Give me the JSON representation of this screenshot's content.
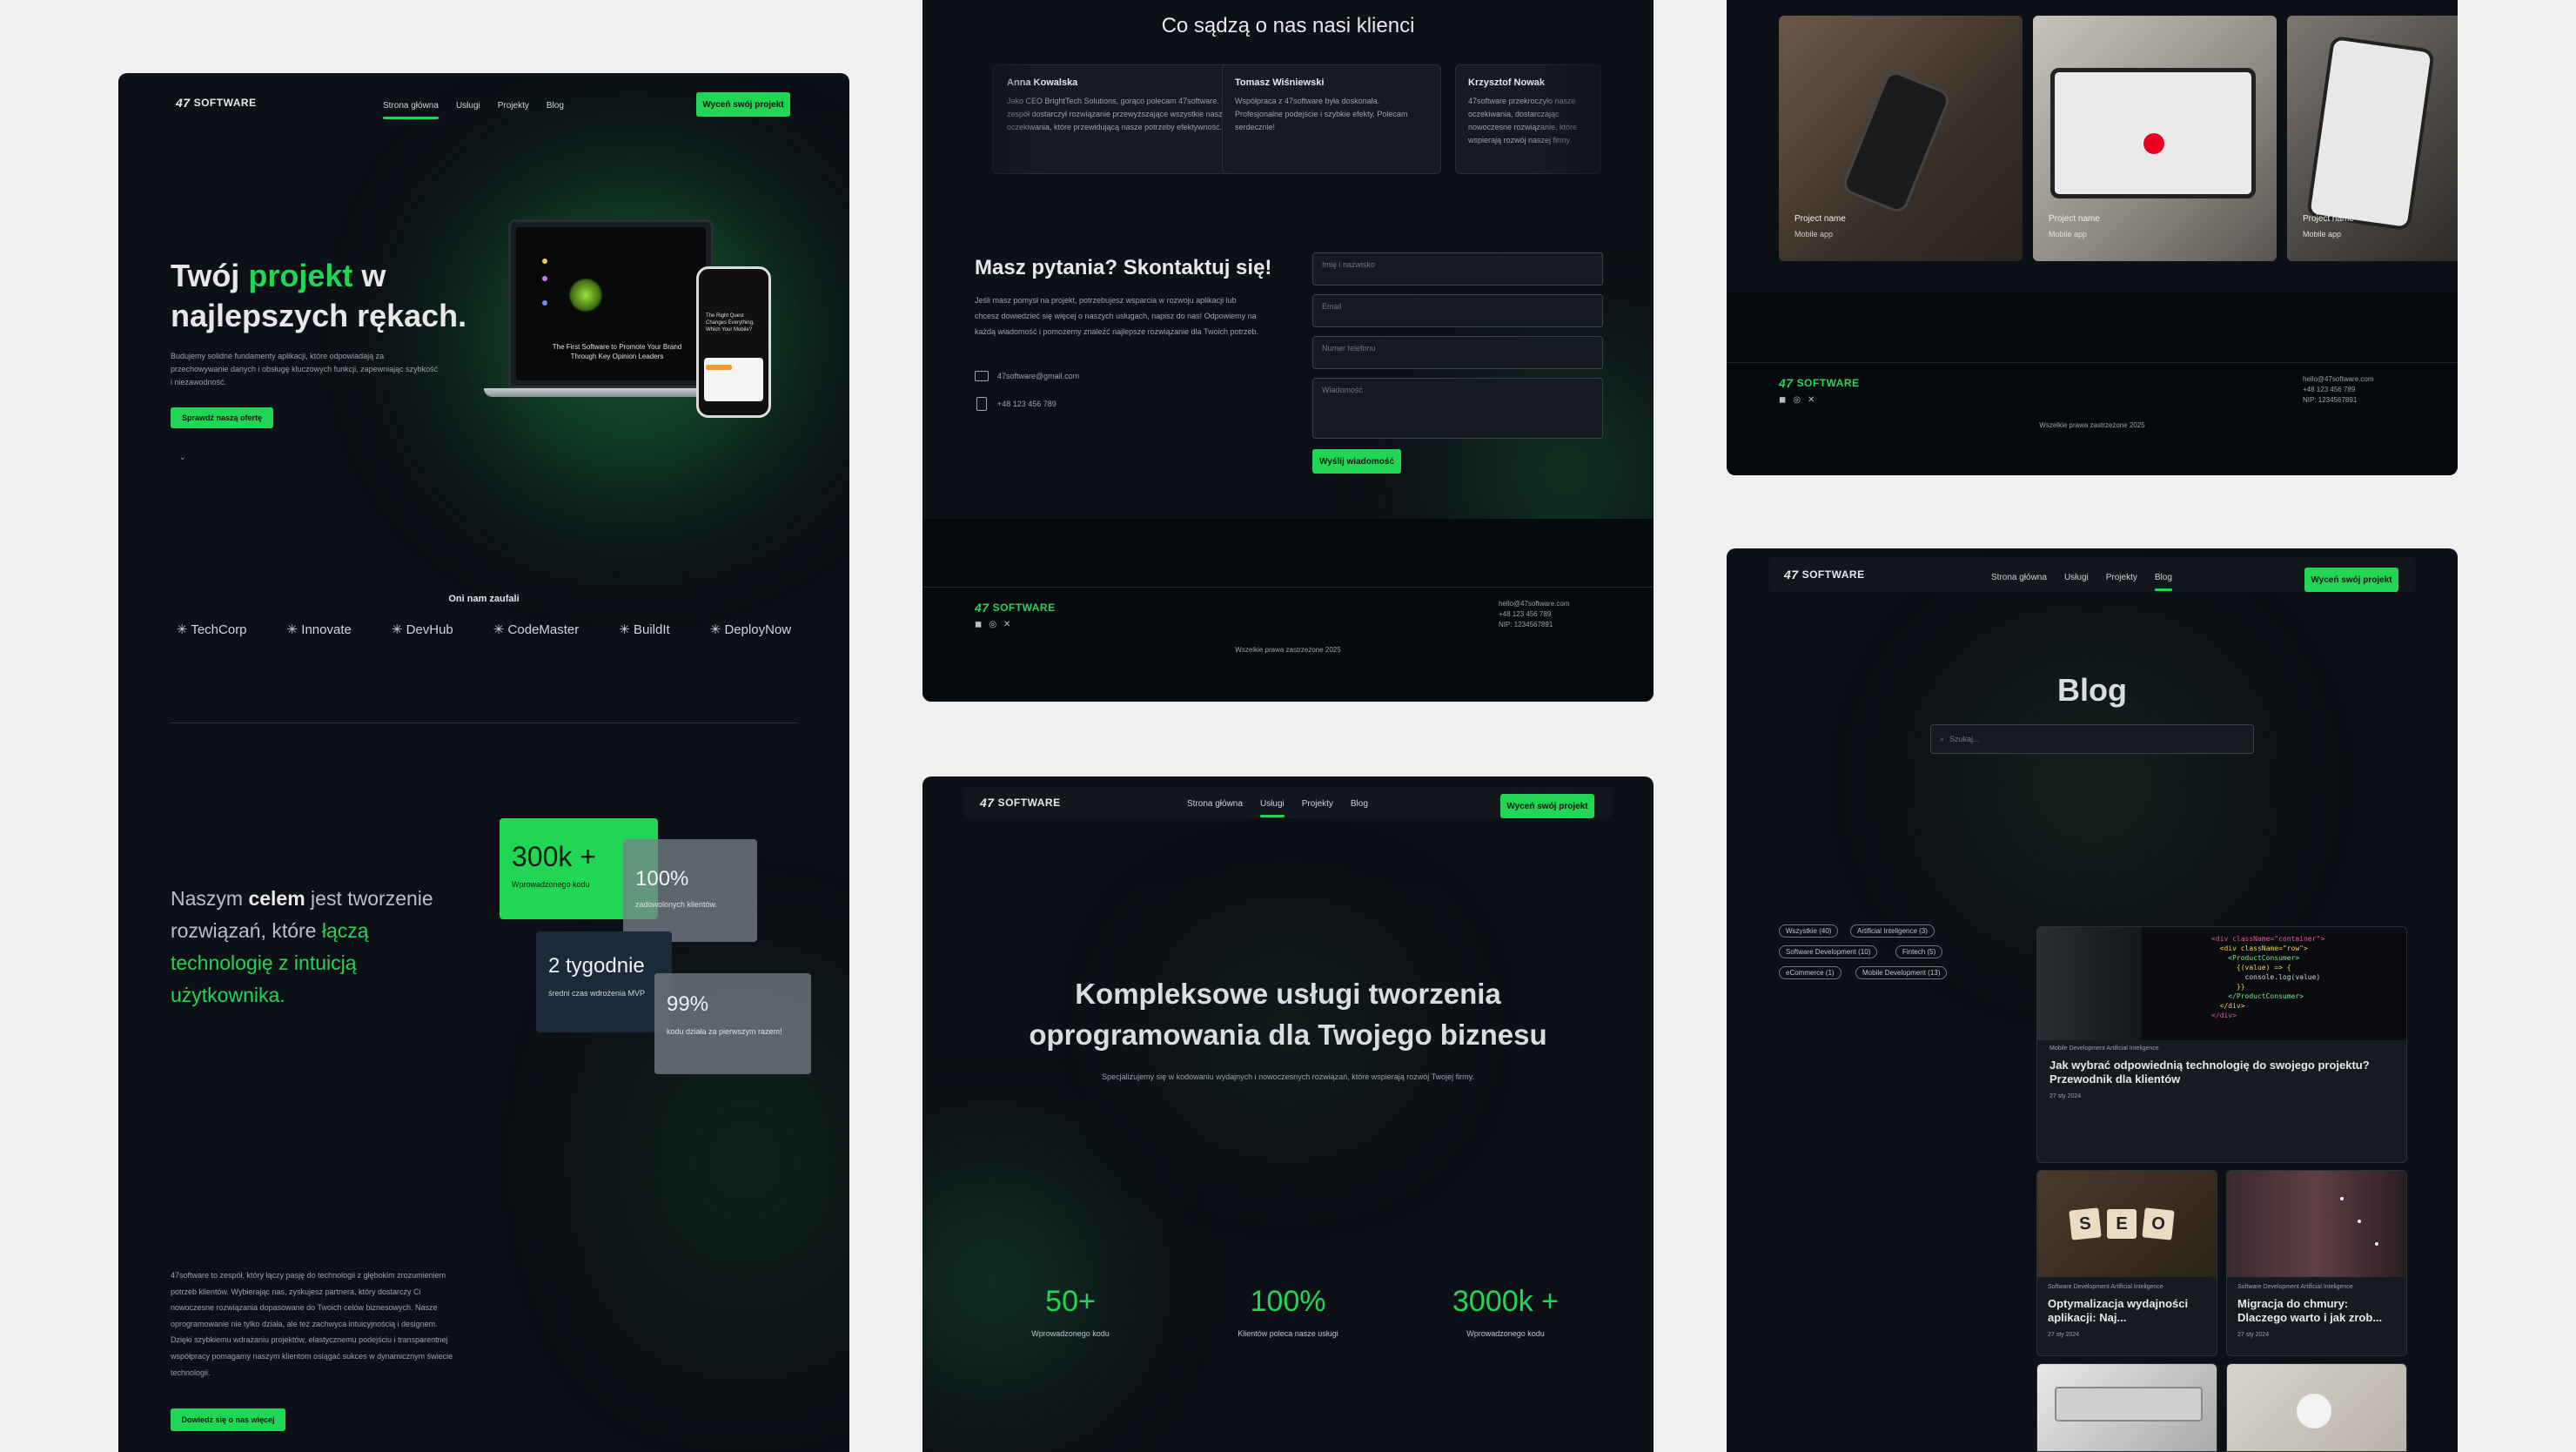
{
  "brand": {
    "logo_mark": "47",
    "logo_text": "SOFTWARE"
  },
  "nav": {
    "home": "Strona główna",
    "services": "Usługi",
    "projects": "Projekty",
    "blog": "Blog",
    "cta": "Wyceń swój projekt"
  },
  "home": {
    "hero_title_1": "Twój ",
    "hero_title_accent": "projekt",
    "hero_title_2": " w",
    "hero_title_3": "najlepszych rękach.",
    "hero_text": "Budujemy solidne fundamenty aplikacji, które odpowiadają za przechowywanie danych i obsługę kluczowych funkcji, zapewniając szybkość i niezawodność.",
    "hero_button": "Sprawdź naszą ofertę",
    "mock_caption_1": "The First Software to Promote Your Brand",
    "mock_caption_2": "Through Key Opinion Leaders",
    "phone_caption": "The Right Quest Changes Everything. Which Your Mobile?",
    "trusted_title": "Oni nam zaufali",
    "clients": [
      "TechCorp",
      "Innovate",
      "DevHub",
      "CodeMaster",
      "BuildIt",
      "DeployNow"
    ],
    "mission_1": "Naszym ",
    "mission_bold_1": "celem",
    "mission_2": " jest tworzenie rozwiązań, które ",
    "mission_accent": "łączą technologię z intuicją użytkownika.",
    "stats": [
      {
        "value": "300k +",
        "label": "Wprowadzonego kodu"
      },
      {
        "value": "100%",
        "label": "zadowolonych klientów."
      },
      {
        "value": "2 tygodnie",
        "label": "średni czas wdrożenia MVP"
      },
      {
        "value": "99%",
        "label": "kodu działa za pierwszym razem!"
      }
    ],
    "about_text": "47software to zespół, który łączy pasję do technologii z głębokim zrozumieniem potrzeb klientów. Wybierając nas, zyskujesz partnera, który dostarczy Ci nowoczesne rozwiązania dopasowane do Twoich celów biznesowych. Nasze oprogramowanie nie tylko działa, ale też zachwyca intuicyjnością i designem. Dzięki szybkiemu wdrażaniu projektów, elastycznemu podejściu i transparentnej współpracy pomagamy naszym klientom osiągać sukces w dynamicznym świecie technologii.",
    "about_button": "Dowiedz się o nas więcej"
  },
  "contact": {
    "testimonials_title": "Co sądzą o  nas nasi klienci",
    "testimonials": [
      {
        "name": "Anna Kowalska",
        "text": "Jako CEO BrightTech Solutions, gorąco polecam 47software. Ich zespół dostarczył rozwiązanie przewyższające wszystkie nasze oczekiwania, które przewidującą nasze potrzeby efektywność."
      },
      {
        "name": "Tomasz Wiśniewski",
        "text": "Współpraca z 47software była doskonała. Profesjonalne podejście i szybkie efekty. Polecam serdecznie!"
      },
      {
        "name": "Krzysztof Nowak",
        "text": "47software przekroczyło nasze oczekiwania, dostarczając nowoczesne rozwiązanie, które wspierają rozwój naszej firmy."
      }
    ],
    "title": "Masz pytania? Skontaktuj się!",
    "text": "Jeśli masz pomysł na projekt, potrzebujesz wsparcia w rozwoju aplikacji lub chcesz dowiedzieć się więcej o naszych usługach, napisz do nas! Odpowiemy na każdą wiadomość i pomożemy znaleźć najlepsze rozwiązanie dla Twoich potrzeb.",
    "email": "47software@gmail.com",
    "phone": "+48 123 456 789",
    "ph_name": "Imię i nazwisko",
    "ph_email": "Email",
    "ph_phone": "Numer telefonu",
    "ph_message": "Wiadomość",
    "submit": "Wyślij wiadomość"
  },
  "footer": {
    "email": "hello@47software.com",
    "phone": "+48 123 456 789",
    "nip": "NIP: 1234567891",
    "rights": "Wszelkie prawa zastrzeżone 2025"
  },
  "projects": [
    {
      "name": "Project name",
      "type": "Mobile app"
    },
    {
      "name": "Project name",
      "type": "Mobile app"
    },
    {
      "name": "Project name",
      "type": "Mobile app"
    }
  ],
  "services": {
    "title_1": "Kompleksowe usługi tworzenia",
    "title_2": "oprogramowania dla Twojego biznesu",
    "subtitle": "Specjalizujemy się w kodowaniu wydajnych i nowoczesnych rozwiązań, które wspierają rozwój Twojej firmy.",
    "stats": [
      {
        "value": "50+",
        "label": "Wprowadzonego kodu"
      },
      {
        "value": "100%",
        "label": "Klientów poleca nasze usługi"
      },
      {
        "value": "3000k +",
        "label": "Wprowadzonego kodu"
      }
    ]
  },
  "blog": {
    "title": "Blog",
    "search_placeholder": "Szukaj...",
    "tags": [
      "Wszystkie (40)",
      "Artificial Inteligence (3)",
      "Software Development (10)",
      "Fintech (5)",
      "eCommerce (1)",
      "Mobile Development (13)"
    ],
    "posts": [
      {
        "cats": "Mobile Development  Artificial Inteligence",
        "title": "Jak wybrać odpowiednią technologię do swojego projektu? Przewodnik dla klientów",
        "date": "27 sty 2024"
      },
      {
        "cats": "Software Development  Artificial Inteligence",
        "title": "Optymalizacja wydajności aplikacji: Naj...",
        "date": "27 sty 2024"
      },
      {
        "cats": "Software Development  Artificial Inteligence",
        "title": "Migracja do chmury: Dlaczego warto i jak zrob...",
        "date": "27 sty 2024"
      }
    ],
    "seo_tiles": [
      "S",
      "E",
      "O"
    ]
  },
  "colors": {
    "accent": "#22d655",
    "background": "#0d1117",
    "page": "#efefef"
  }
}
